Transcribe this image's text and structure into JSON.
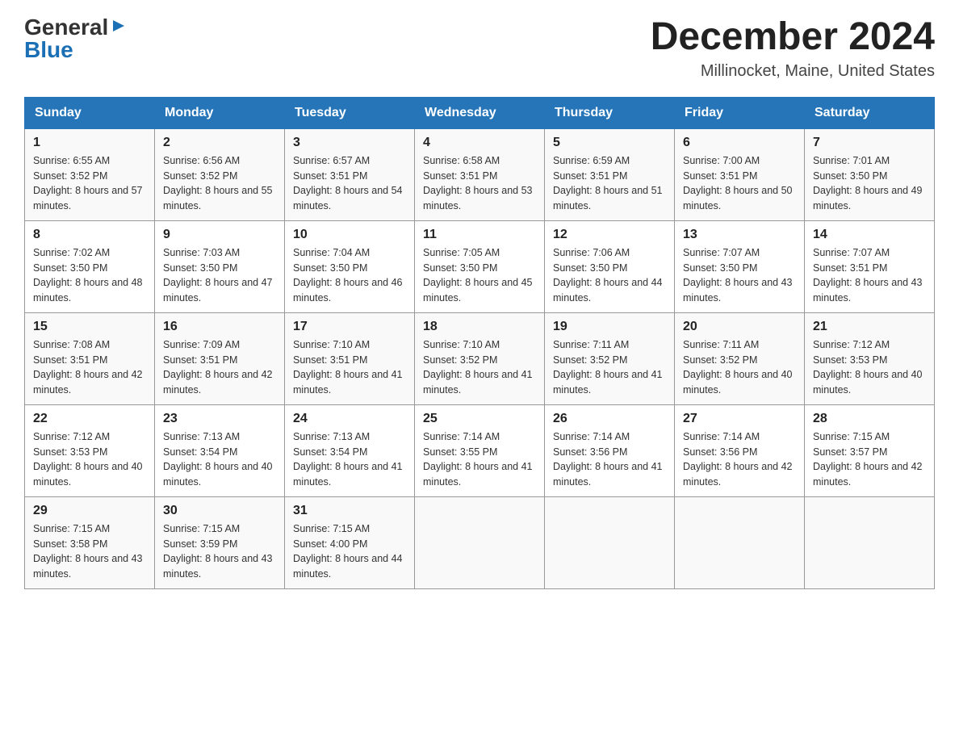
{
  "header": {
    "logo": {
      "general": "General",
      "blue": "Blue",
      "arrow": "▶"
    },
    "title": "December 2024",
    "location": "Millinocket, Maine, United States"
  },
  "days_of_week": [
    "Sunday",
    "Monday",
    "Tuesday",
    "Wednesday",
    "Thursday",
    "Friday",
    "Saturday"
  ],
  "weeks": [
    [
      {
        "day": "1",
        "sunrise": "6:55 AM",
        "sunset": "3:52 PM",
        "daylight": "8 hours and 57 minutes."
      },
      {
        "day": "2",
        "sunrise": "6:56 AM",
        "sunset": "3:52 PM",
        "daylight": "8 hours and 55 minutes."
      },
      {
        "day": "3",
        "sunrise": "6:57 AM",
        "sunset": "3:51 PM",
        "daylight": "8 hours and 54 minutes."
      },
      {
        "day": "4",
        "sunrise": "6:58 AM",
        "sunset": "3:51 PM",
        "daylight": "8 hours and 53 minutes."
      },
      {
        "day": "5",
        "sunrise": "6:59 AM",
        "sunset": "3:51 PM",
        "daylight": "8 hours and 51 minutes."
      },
      {
        "day": "6",
        "sunrise": "7:00 AM",
        "sunset": "3:51 PM",
        "daylight": "8 hours and 50 minutes."
      },
      {
        "day": "7",
        "sunrise": "7:01 AM",
        "sunset": "3:50 PM",
        "daylight": "8 hours and 49 minutes."
      }
    ],
    [
      {
        "day": "8",
        "sunrise": "7:02 AM",
        "sunset": "3:50 PM",
        "daylight": "8 hours and 48 minutes."
      },
      {
        "day": "9",
        "sunrise": "7:03 AM",
        "sunset": "3:50 PM",
        "daylight": "8 hours and 47 minutes."
      },
      {
        "day": "10",
        "sunrise": "7:04 AM",
        "sunset": "3:50 PM",
        "daylight": "8 hours and 46 minutes."
      },
      {
        "day": "11",
        "sunrise": "7:05 AM",
        "sunset": "3:50 PM",
        "daylight": "8 hours and 45 minutes."
      },
      {
        "day": "12",
        "sunrise": "7:06 AM",
        "sunset": "3:50 PM",
        "daylight": "8 hours and 44 minutes."
      },
      {
        "day": "13",
        "sunrise": "7:07 AM",
        "sunset": "3:50 PM",
        "daylight": "8 hours and 43 minutes."
      },
      {
        "day": "14",
        "sunrise": "7:07 AM",
        "sunset": "3:51 PM",
        "daylight": "8 hours and 43 minutes."
      }
    ],
    [
      {
        "day": "15",
        "sunrise": "7:08 AM",
        "sunset": "3:51 PM",
        "daylight": "8 hours and 42 minutes."
      },
      {
        "day": "16",
        "sunrise": "7:09 AM",
        "sunset": "3:51 PM",
        "daylight": "8 hours and 42 minutes."
      },
      {
        "day": "17",
        "sunrise": "7:10 AM",
        "sunset": "3:51 PM",
        "daylight": "8 hours and 41 minutes."
      },
      {
        "day": "18",
        "sunrise": "7:10 AM",
        "sunset": "3:52 PM",
        "daylight": "8 hours and 41 minutes."
      },
      {
        "day": "19",
        "sunrise": "7:11 AM",
        "sunset": "3:52 PM",
        "daylight": "8 hours and 41 minutes."
      },
      {
        "day": "20",
        "sunrise": "7:11 AM",
        "sunset": "3:52 PM",
        "daylight": "8 hours and 40 minutes."
      },
      {
        "day": "21",
        "sunrise": "7:12 AM",
        "sunset": "3:53 PM",
        "daylight": "8 hours and 40 minutes."
      }
    ],
    [
      {
        "day": "22",
        "sunrise": "7:12 AM",
        "sunset": "3:53 PM",
        "daylight": "8 hours and 40 minutes."
      },
      {
        "day": "23",
        "sunrise": "7:13 AM",
        "sunset": "3:54 PM",
        "daylight": "8 hours and 40 minutes."
      },
      {
        "day": "24",
        "sunrise": "7:13 AM",
        "sunset": "3:54 PM",
        "daylight": "8 hours and 41 minutes."
      },
      {
        "day": "25",
        "sunrise": "7:14 AM",
        "sunset": "3:55 PM",
        "daylight": "8 hours and 41 minutes."
      },
      {
        "day": "26",
        "sunrise": "7:14 AM",
        "sunset": "3:56 PM",
        "daylight": "8 hours and 41 minutes."
      },
      {
        "day": "27",
        "sunrise": "7:14 AM",
        "sunset": "3:56 PM",
        "daylight": "8 hours and 42 minutes."
      },
      {
        "day": "28",
        "sunrise": "7:15 AM",
        "sunset": "3:57 PM",
        "daylight": "8 hours and 42 minutes."
      }
    ],
    [
      {
        "day": "29",
        "sunrise": "7:15 AM",
        "sunset": "3:58 PM",
        "daylight": "8 hours and 43 minutes."
      },
      {
        "day": "30",
        "sunrise": "7:15 AM",
        "sunset": "3:59 PM",
        "daylight": "8 hours and 43 minutes."
      },
      {
        "day": "31",
        "sunrise": "7:15 AM",
        "sunset": "4:00 PM",
        "daylight": "8 hours and 44 minutes."
      },
      null,
      null,
      null,
      null
    ]
  ]
}
